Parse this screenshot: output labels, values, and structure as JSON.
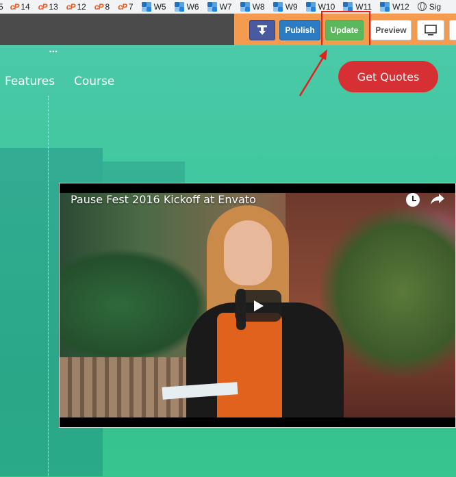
{
  "bookmarks": [
    {
      "label": "5",
      "icon": "cpanel-icon"
    },
    {
      "label": "14",
      "icon": "cpanel-icon"
    },
    {
      "label": "13",
      "icon": "cpanel-icon"
    },
    {
      "label": "12",
      "icon": "cpanel-icon"
    },
    {
      "label": "8",
      "icon": "cpanel-icon"
    },
    {
      "label": "7",
      "icon": "cpanel-icon"
    },
    {
      "label": "W5",
      "icon": "site-icon"
    },
    {
      "label": "W6",
      "icon": "site-icon"
    },
    {
      "label": "W7",
      "icon": "site-icon"
    },
    {
      "label": "W8",
      "icon": "site-icon"
    },
    {
      "label": "W9",
      "icon": "site-icon"
    },
    {
      "label": "W10",
      "icon": "site-icon"
    },
    {
      "label": "W11",
      "icon": "site-icon"
    },
    {
      "label": "W12",
      "icon": "site-icon"
    },
    {
      "label": "Sig",
      "icon": "globe-icon"
    }
  ],
  "toolbar": {
    "publish_label": "Publish",
    "update_label": "Update",
    "preview_label": "Preview",
    "colors": {
      "dark": "#4b4b4b",
      "accent": "#f59b50",
      "publish": "#2d7bc3",
      "update": "#5cb85c",
      "highlight": "#e3201b"
    }
  },
  "nav": {
    "features": "Features",
    "course": "Course",
    "cta": "Get Quotes"
  },
  "video": {
    "title": "Pause Fest 2016 Kickoff at Envato"
  }
}
